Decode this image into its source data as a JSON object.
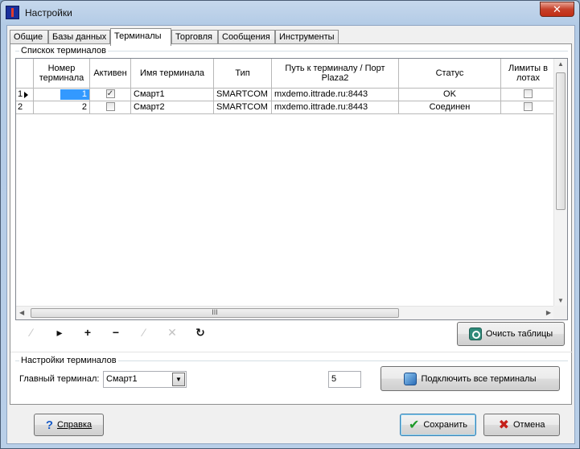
{
  "window": {
    "title": "Настройки",
    "close_label": "✕"
  },
  "tabs": [
    {
      "label": "Общие"
    },
    {
      "label": "Базы данных"
    },
    {
      "label": "Терминалы",
      "active": true
    },
    {
      "label": "Торговля"
    },
    {
      "label": "Сообщения"
    },
    {
      "label": "Инструменты"
    }
  ],
  "terminals_group": {
    "label": "Спискок терминалов"
  },
  "grid": {
    "columns": [
      "Номер терминала",
      "Активен",
      "Имя терминала",
      "Тип",
      "Путь к терминалу / Порт Plaza2",
      "Статус",
      "Лимиты в лотах"
    ],
    "rows": [
      {
        "index": "1",
        "number": "1",
        "active": true,
        "name": "Смарт1",
        "type": "SMARTCOM",
        "path": "mxdemo.ittrade.ru:8443",
        "status": "OK",
        "limits_in_lots": false
      },
      {
        "index": "2",
        "number": "2",
        "active": false,
        "name": "Смарт2",
        "type": "SMARTCOM",
        "path": "mxdemo.ittrade.ru:8443",
        "status": "Соединен",
        "limits_in_lots": false
      }
    ],
    "hscroll_grip": "III"
  },
  "navigator": {
    "first": "⁄",
    "next": "▸",
    "add": "+",
    "delete": "−",
    "edit": "⁄",
    "cancel": "✕",
    "refresh": "↻"
  },
  "clear_tables_button": "Очисть таблицы",
  "settings_group": {
    "label": "Настройки терминалов",
    "main_terminal_label": "Главный терминал:",
    "main_terminal_value": "Смарт1",
    "number_value": "5",
    "connect_all_button": "Подключить все терминалы"
  },
  "footer": {
    "help_button": "Справка",
    "save_button": "Сохранить",
    "cancel_button": "Отмена"
  }
}
